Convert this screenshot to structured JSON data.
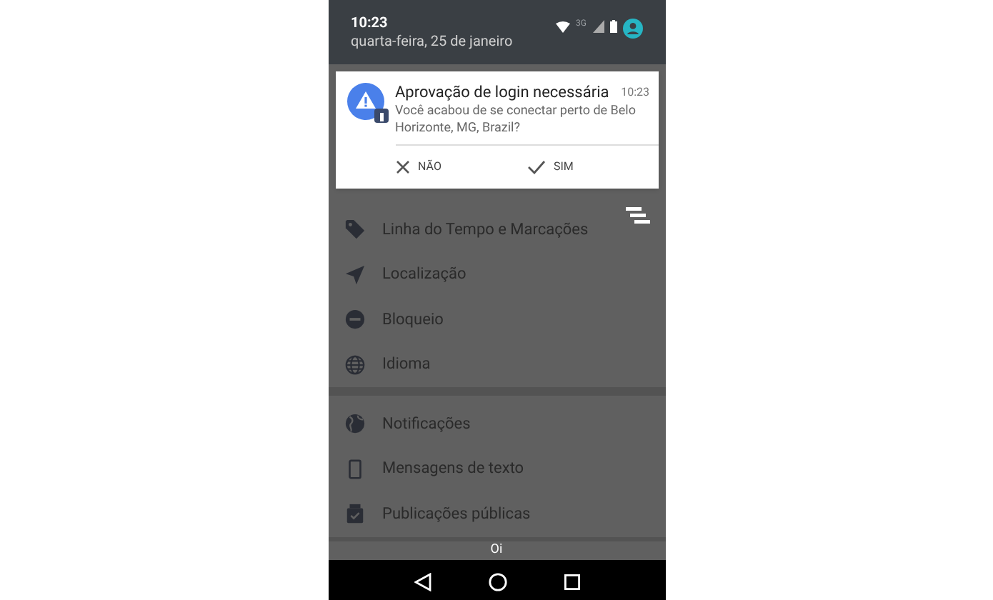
{
  "status_bar": {
    "time": "10:23",
    "date": "quarta-feira, 25 de janeiro",
    "network": "3G"
  },
  "notification": {
    "title": "Aprovação de login necessária",
    "time": "10:23",
    "message": "Você acabou de se conectar perto de Belo Horizonte, MG, Brazil?",
    "actions": [
      {
        "kind": "decline",
        "label": "NÃO"
      },
      {
        "kind": "accept",
        "label": "SIM"
      }
    ]
  },
  "menu_sections": [
    {
      "items": [
        {
          "label": "Linha do Tempo e Marcações"
        },
        {
          "label": "Localização"
        },
        {
          "label": "Bloqueio"
        },
        {
          "label": "Idioma"
        }
      ]
    },
    {
      "items": [
        {
          "label": "Notificações"
        },
        {
          "label": "Mensagens de texto"
        },
        {
          "label": "Publicações públicas"
        }
      ]
    }
  ],
  "carrier": "Oi"
}
